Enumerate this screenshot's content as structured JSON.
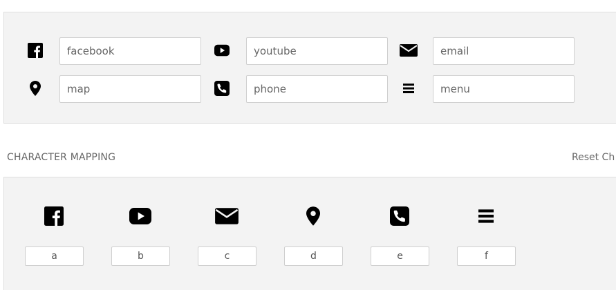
{
  "icon_fields": [
    {
      "icon": "facebook-icon",
      "placeholder": "facebook"
    },
    {
      "icon": "youtube-icon",
      "placeholder": "youtube"
    },
    {
      "icon": "email-icon",
      "placeholder": "email"
    },
    {
      "icon": "map-marker-icon",
      "placeholder": "map"
    },
    {
      "icon": "phone-icon",
      "placeholder": "phone"
    },
    {
      "icon": "menu-icon",
      "placeholder": "menu"
    }
  ],
  "section": {
    "title": "CHARACTER MAPPING",
    "reset_label": "Reset Ch"
  },
  "character_map": [
    {
      "icon": "facebook-icon",
      "key": "a"
    },
    {
      "icon": "youtube-icon",
      "key": "b"
    },
    {
      "icon": "email-icon",
      "key": "c"
    },
    {
      "icon": "map-marker-icon",
      "key": "d"
    },
    {
      "icon": "phone-icon",
      "key": "e"
    },
    {
      "icon": "menu-icon",
      "key": "f"
    }
  ],
  "colors": {
    "panel_bg": "#f3f3f3",
    "icon": "#000000",
    "text": "#666666"
  }
}
